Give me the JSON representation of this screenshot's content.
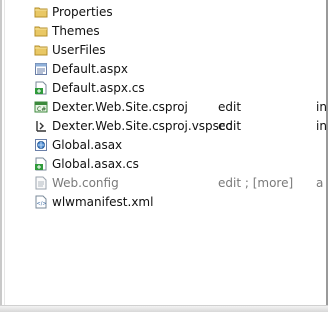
{
  "files": [
    {
      "name": "Properties",
      "icon": "folder-icon",
      "status": "",
      "extra": "",
      "dim": false
    },
    {
      "name": "Themes",
      "icon": "folder-icon",
      "status": "",
      "extra": "",
      "dim": false
    },
    {
      "name": "UserFiles",
      "icon": "folder-icon",
      "status": "",
      "extra": "",
      "dim": false
    },
    {
      "name": "Default.aspx",
      "icon": "aspx-page-icon",
      "status": "",
      "extra": "",
      "dim": false
    },
    {
      "name": "Default.aspx.cs",
      "icon": "csharp-file-icon",
      "status": "",
      "extra": "",
      "dim": false
    },
    {
      "name": "Dexter.Web.Site.csproj",
      "icon": "csproj-icon",
      "status": "edit",
      "extra": "in",
      "dim": false
    },
    {
      "name": "Dexter.Web.Site.csproj.vspscc",
      "icon": "source-control-icon",
      "status": "edit",
      "extra": "in",
      "dim": false
    },
    {
      "name": "Global.asax",
      "icon": "asax-file-icon",
      "status": "",
      "extra": "",
      "dim": false
    },
    {
      "name": "Global.asax.cs",
      "icon": "csharp-file-icon",
      "status": "",
      "extra": "",
      "dim": false
    },
    {
      "name": "Web.config",
      "icon": "config-file-icon",
      "status": "edit ; [more]",
      "extra": "a",
      "dim": true
    },
    {
      "name": "wlwmanifest.xml",
      "icon": "xml-file-icon",
      "status": "",
      "extra": "",
      "dim": false
    }
  ]
}
